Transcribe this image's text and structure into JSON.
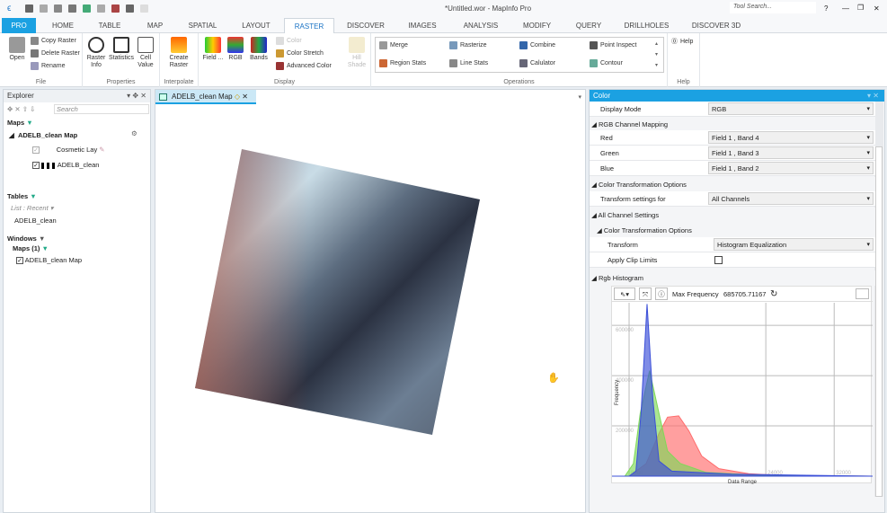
{
  "window": {
    "title": "*Untitled.wor - MapInfo Pro",
    "tool_search_placeholder": "Tool Search...",
    "help": "?",
    "minimize": "—",
    "restore": "❐",
    "close": "✕"
  },
  "tabs": [
    "PRO",
    "HOME",
    "TABLE",
    "MAP",
    "SPATIAL",
    "LAYOUT",
    "RASTER",
    "DISCOVER",
    "IMAGES",
    "ANALYSIS",
    "MODIFY",
    "QUERY",
    "DRILLHOLES",
    "DISCOVER 3D"
  ],
  "active_tab": "RASTER",
  "ribbon": {
    "file": {
      "label": "File",
      "open": "Open",
      "copy": "Copy Raster",
      "delete": "Delete Raster",
      "rename": "Rename"
    },
    "properties": {
      "label": "Properties",
      "raster_info": "Raster Info",
      "statistics": "Statistics",
      "cell_value": "Cell Value"
    },
    "interpolate": {
      "label": "Interpolate",
      "create": "Create Raster"
    },
    "display": {
      "label": "Display",
      "field": "Field ...",
      "rgb": "RGB",
      "bands": "Bands",
      "color": "Color",
      "color_stretch": "Color Stretch",
      "advanced_color": "Advanced Color",
      "hill_shade": "Hill Shade"
    },
    "operations": {
      "label": "Operations",
      "items": [
        "Merge",
        "Rasterize",
        "Combine",
        "Point Inspect",
        "Region Stats",
        "Line Stats",
        "Calulator",
        "Contour"
      ]
    },
    "help": {
      "label": "Help",
      "button": "Help"
    }
  },
  "explorer": {
    "title": "Explorer",
    "search_placeholder": "Search",
    "maps_label": "Maps",
    "map_name": "ADELB_clean Map",
    "layers": [
      {
        "name": "Cosmetic Lay",
        "checked": true
      },
      {
        "name": "ADELB_clean",
        "checked": true
      }
    ],
    "tables_label": "Tables",
    "list_recent": "List : Recent",
    "tables": [
      "ADELB_clean"
    ],
    "windows_label": "Windows",
    "maps_count": "Maps (1)",
    "windows": [
      "ADELB_clean Map"
    ]
  },
  "map_tab": "ADELB_clean Map",
  "color_panel": {
    "title": "Color",
    "display_mode_label": "Display Mode",
    "display_mode": "RGB",
    "rgb_mapping_label": "RGB Channel Mapping",
    "red_label": "Red",
    "red": "Field 1 , Band 4",
    "green_label": "Green",
    "green": "Field 1 , Band 3",
    "blue_label": "Blue",
    "blue": "Field 1 , Band 2",
    "cto_label": "Color Transformation Options",
    "transform_for_label": "Transform settings for",
    "transform_for": "All Channels",
    "all_channel_label": "All Channel Settings",
    "cto2_label": "Color Transformation Options",
    "transform_label": "Transform",
    "transform": "Histogram Equalization",
    "clip_label": "Apply Clip Limits",
    "clip_checked": false,
    "histogram_label": "Rgb Histogram",
    "max_freq_label": "Max Frequency",
    "max_freq": "685705.71167"
  },
  "chart_data": {
    "type": "area",
    "xlabel": "Data Range",
    "ylabel": "Frequency",
    "xlim": [
      6000,
      36500
    ],
    "ylim": [
      0,
      690000
    ],
    "x_ticks": [
      "8000",
      "24000",
      "32000"
    ],
    "x_tick_values": [
      8000,
      24000,
      32000
    ],
    "y_ticks": [
      "200000",
      "400000",
      "600000"
    ],
    "y_tick_values": [
      200000,
      400000,
      600000
    ],
    "grid": true,
    "series": [
      {
        "color": "#ff6b6b",
        "points": [
          [
            6000,
            0
          ],
          [
            8000,
            0
          ],
          [
            10000,
            50000
          ],
          [
            11500,
            170000
          ],
          [
            12500,
            235000
          ],
          [
            13800,
            240000
          ],
          [
            15000,
            180000
          ],
          [
            16500,
            80000
          ],
          [
            18500,
            30000
          ],
          [
            22000,
            10000
          ],
          [
            26000,
            2000
          ],
          [
            36500,
            0
          ]
        ]
      },
      {
        "color": "#7ed957",
        "points": [
          [
            6000,
            0
          ],
          [
            7500,
            0
          ],
          [
            8500,
            50000
          ],
          [
            9300,
            250000
          ],
          [
            10400,
            420000
          ],
          [
            11500,
            250000
          ],
          [
            12500,
            100000
          ],
          [
            14000,
            50000
          ],
          [
            17000,
            15000
          ],
          [
            24000,
            3000
          ],
          [
            36500,
            0
          ]
        ]
      },
      {
        "color": "#3b4fd8",
        "points": [
          [
            6000,
            0
          ],
          [
            8000,
            0
          ],
          [
            8800,
            20000
          ],
          [
            9400,
            250000
          ],
          [
            10100,
            685000
          ],
          [
            10800,
            300000
          ],
          [
            11500,
            60000
          ],
          [
            13000,
            20000
          ],
          [
            20000,
            8000
          ],
          [
            36500,
            0
          ]
        ]
      }
    ]
  }
}
